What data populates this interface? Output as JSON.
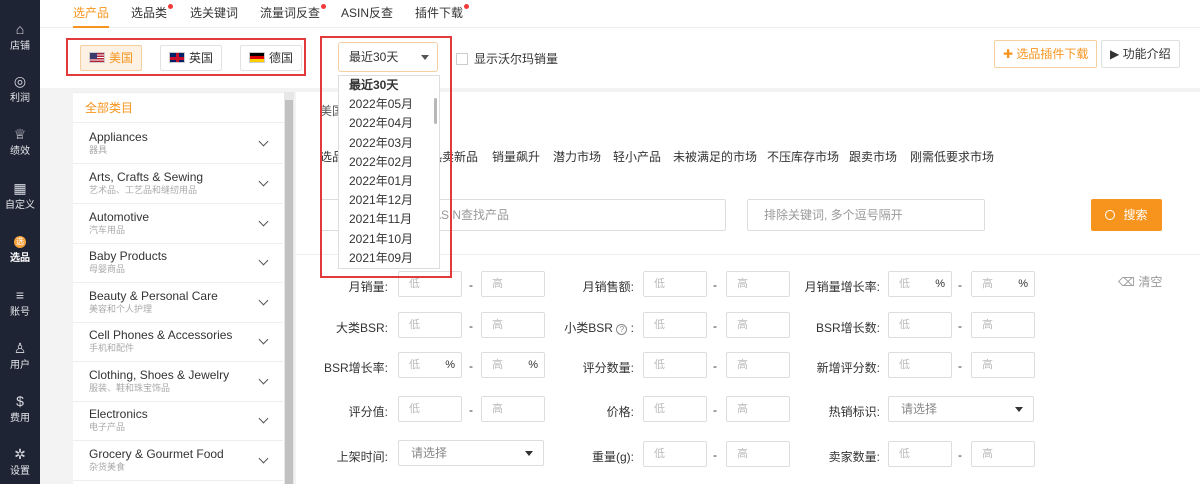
{
  "nav": [
    {
      "icon": "home-icon",
      "label": "店铺"
    },
    {
      "icon": "money-bag-icon",
      "label": "利润"
    },
    {
      "icon": "trophy-icon",
      "label": "绩效"
    },
    {
      "icon": "grid-icon",
      "label": "自定义"
    },
    {
      "icon": "select-product-icon",
      "label": "选品",
      "glyph": "选"
    },
    {
      "icon": "list-icon",
      "label": "账号"
    },
    {
      "icon": "user-icon",
      "label": "用户"
    },
    {
      "icon": "dollar-icon",
      "label": "费用"
    },
    {
      "icon": "gear-icon",
      "label": "设置"
    }
  ],
  "tabs": [
    "选产品",
    "选品类",
    "选关键词",
    "流量词反查",
    "ASIN反查",
    "插件下载"
  ],
  "countries": [
    "美国",
    "英国",
    "德国"
  ],
  "month_select": {
    "value": "最近30天"
  },
  "months": [
    "最近30天",
    "2022年05月",
    "2022年04月",
    "2022年03月",
    "2022年02月",
    "2022年01月",
    "2021年12月",
    "2021年11月",
    "2021年10月",
    "2021年09月"
  ],
  "walmart_label": "显示沃尔玛销量",
  "plugin_download": "选品插件下载",
  "feature_intro": "功能介绍",
  "category_header": "全部类目",
  "categories": [
    {
      "en": "Appliances",
      "cn": "器具"
    },
    {
      "en": "Arts, Crafts & Sewing",
      "cn": "艺术品、工艺品和缝纫用品"
    },
    {
      "en": "Automotive",
      "cn": "汽车用品"
    },
    {
      "en": "Baby Products",
      "cn": "母婴商品"
    },
    {
      "en": "Beauty & Personal Care",
      "cn": "美容和个人护理"
    },
    {
      "en": "Cell Phones & Accessories",
      "cn": "手机和配件"
    },
    {
      "en": "Clothing, Shoes & Jewelry",
      "cn": "服装、鞋和珠宝饰品"
    },
    {
      "en": "Electronics",
      "cn": "电子产品"
    },
    {
      "en": "Grocery & Gourmet Food",
      "cn": "杂货美食"
    }
  ],
  "breadcrumb": "美国",
  "market_prefix": "选品",
  "market_tags": [
    "热卖新品",
    "销量飙升",
    "潜力市场",
    "轻小产品",
    "未被满足的市场",
    "不压库存市场",
    "跟卖市场",
    "刚需低要求市场"
  ],
  "keyword_placeholder": "ASIN查找产品",
  "exclude_placeholder": "排除关键词, 多个逗号隔开",
  "search_label": "搜索",
  "clear_label": "清空",
  "filter_low": "低",
  "filter_high": "高",
  "pct": "%",
  "select_placeholder": "请选择",
  "filters": {
    "monthly_sales": "月销量:",
    "monthly_revenue": "月销售额:",
    "sales_growth": "月销量增长率:",
    "main_bsr": "大类BSR:",
    "sub_bsr": "小类BSR",
    "bsr_growth_count": "BSR增长数:",
    "bsr_growth_rate": "BSR增长率:",
    "review_count": "评分数量:",
    "new_reviews": "新增评分数:",
    "rating": "评分值:",
    "price": "价格:",
    "hot_tag": "热销标识:",
    "listing_time": "上架时间:",
    "weight": "重量(g):",
    "seller_count": "卖家数量:"
  }
}
